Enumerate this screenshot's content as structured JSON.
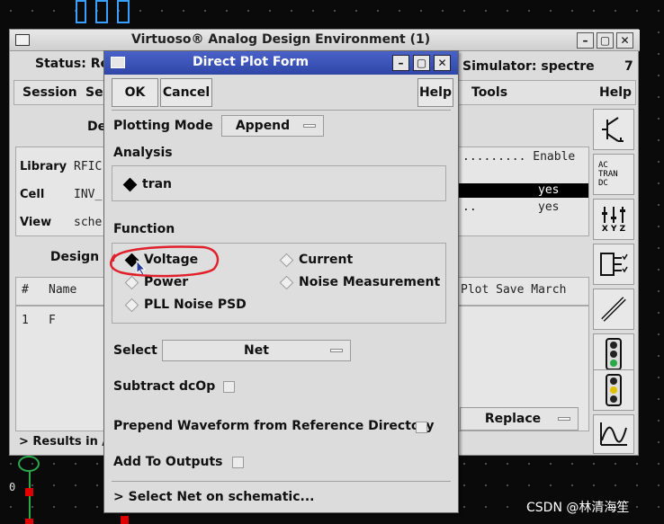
{
  "ade": {
    "title": "Virtuoso® Analog Design Environment (1)",
    "status_label": "Status: Re",
    "simulator_label": "Simulator: spectre",
    "window_number": "7",
    "menus": [
      "Session",
      "Se",
      "Tools",
      "Help"
    ],
    "design_label": "De",
    "library_label": "Library",
    "library_value": "RFIC",
    "cell_label": "Cell",
    "cell_value": "INV_",
    "view_label": "View",
    "view_value": "sche",
    "enable_header": "......... Enable",
    "analysis_rows": [
      "yes",
      "yes"
    ],
    "analysis_dots": "..",
    "design_btn": "Design",
    "outputs_header": {
      "num": "#",
      "name": "Name",
      "cols": "Plot Save March"
    },
    "outputs_row": {
      "num": "1",
      "name": "F"
    },
    "results_label": "> Results in /",
    "replace_label": "Replace",
    "sidebar_icons": [
      "transistor-icon",
      "analysis-type-icon",
      "variables-icon",
      "outputs-icon",
      "probe-icon",
      "run-icon",
      "stop-icon",
      "waveform-icon"
    ],
    "analysis_type_lines": [
      "AC",
      "TRAN",
      "DC"
    ],
    "variables_text": "X Y Z"
  },
  "form": {
    "title": "Direct Plot Form",
    "ok": "OK",
    "cancel": "Cancel",
    "help": "Help",
    "plotting_mode_label": "Plotting Mode",
    "plotting_mode_value": "Append",
    "analysis_label": "Analysis",
    "analysis_option": "tran",
    "function_label": "Function",
    "functions": {
      "voltage": "Voltage",
      "current": "Current",
      "power": "Power",
      "noise": "Noise Measurement",
      "pll": "PLL Noise PSD"
    },
    "select_label": "Select",
    "select_value": "Net",
    "subtract_label": "Subtract dcOp",
    "prepend_label": "Prepend Waveform from Reference Directory",
    "add_outputs_label": "Add To Outputs",
    "status_line": "> Select Net on schematic..."
  },
  "schematic": {
    "label_zero": "0"
  },
  "watermark": "CSDN @林清海笙",
  "colors": {
    "highlight_circle": "#e0202a",
    "title_bar": "#3a52b8",
    "schematic_red": "#e00000",
    "schematic_green": "#2aa84a"
  }
}
